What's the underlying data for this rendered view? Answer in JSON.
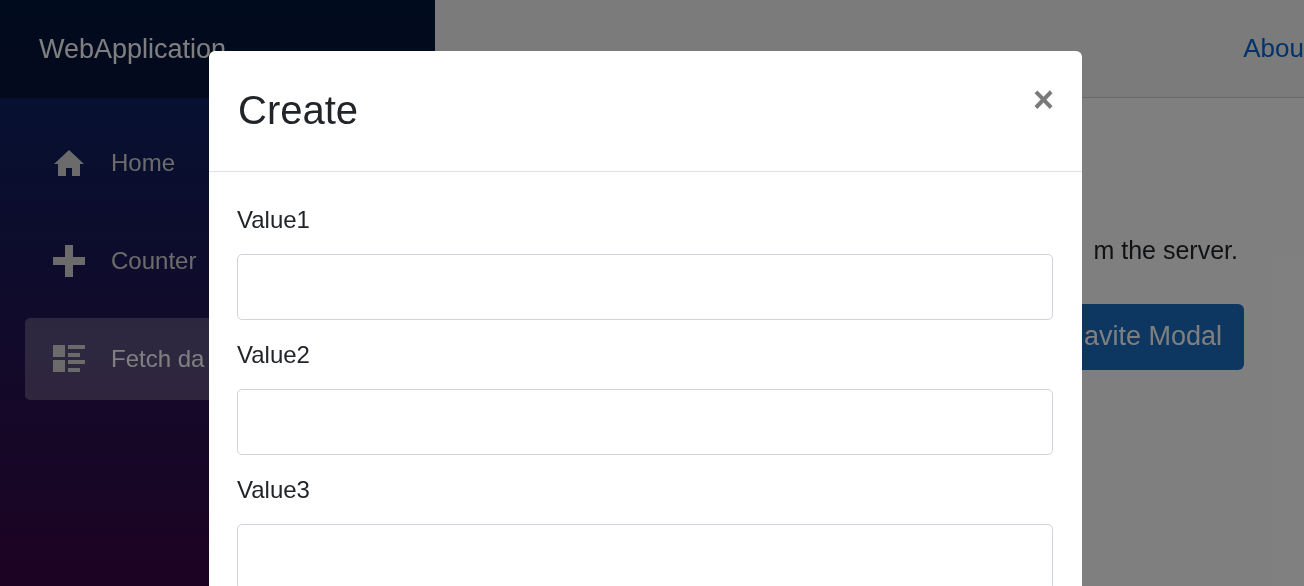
{
  "sidebar": {
    "brand": "WebApplication",
    "items": [
      {
        "label": "Home",
        "selected": false
      },
      {
        "label": "Counter",
        "selected": false
      },
      {
        "label": "Fetch da",
        "selected": true
      }
    ]
  },
  "top_bar": {
    "link": "Abou"
  },
  "page": {
    "text": "m the server.",
    "button": "avite Modal"
  },
  "modal": {
    "title": "Create",
    "close": "×",
    "fields": [
      {
        "label": "Value1"
      },
      {
        "label": "Value2"
      },
      {
        "label": "Value3"
      }
    ]
  }
}
